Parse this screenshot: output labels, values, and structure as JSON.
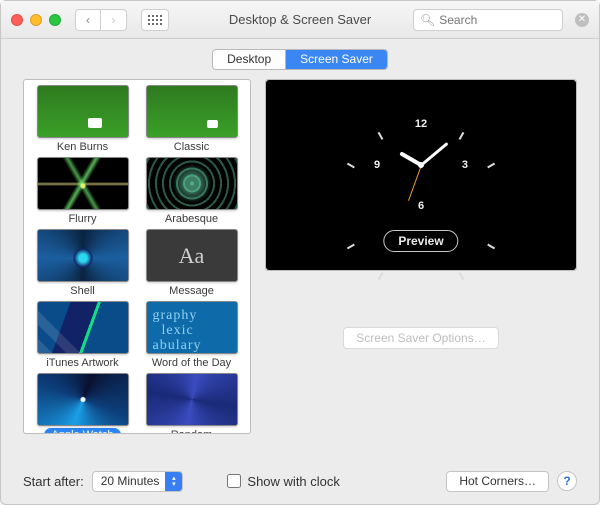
{
  "window": {
    "title": "Desktop & Screen Saver"
  },
  "search": {
    "placeholder": "Search"
  },
  "tabs": {
    "desktop": "Desktop",
    "screensaver": "Screen Saver",
    "active": "screensaver"
  },
  "screensavers": [
    {
      "name": "Ken Burns",
      "kind": "kenburns",
      "selected": false
    },
    {
      "name": "Classic",
      "kind": "classic",
      "selected": false
    },
    {
      "name": "Flurry",
      "kind": "flurry",
      "selected": false
    },
    {
      "name": "Arabesque",
      "kind": "arabesque",
      "selected": false
    },
    {
      "name": "Shell",
      "kind": "shell",
      "selected": false
    },
    {
      "name": "Message",
      "kind": "message",
      "selected": false
    },
    {
      "name": "iTunes Artwork",
      "kind": "itunes",
      "selected": false
    },
    {
      "name": "Word of the Day",
      "kind": "word",
      "selected": false
    },
    {
      "name": "Apple Watch",
      "kind": "applewatch",
      "selected": true
    },
    {
      "name": "Random",
      "kind": "random",
      "selected": false
    }
  ],
  "preview": {
    "button": "Preview",
    "clock_numbers": [
      "12",
      "3",
      "6",
      "9"
    ]
  },
  "options_button": "Screen Saver Options…",
  "bottom": {
    "start_after_label": "Start after:",
    "start_after_value": "20 Minutes",
    "show_with_clock": "Show with clock",
    "show_with_clock_checked": false,
    "hot_corners": "Hot Corners…"
  }
}
